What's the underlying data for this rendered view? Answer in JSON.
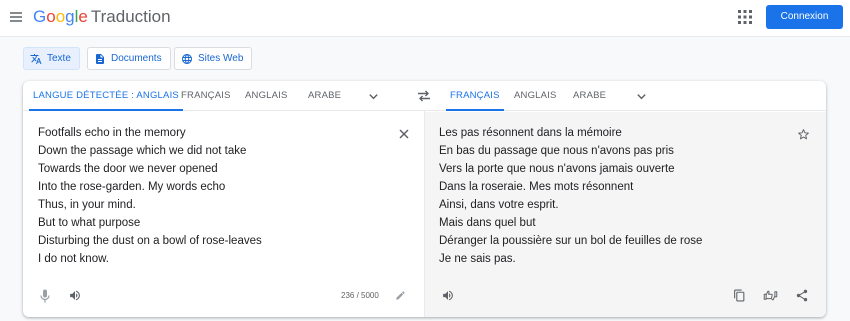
{
  "app": {
    "logo_letters": [
      "G",
      "o",
      "o",
      "g",
      "l",
      "e"
    ],
    "product_name": "Traduction",
    "sign_in_label": "Connexion",
    "menu_icon": "hamburger-menu-icon",
    "apps_icon": "apps-grid-icon"
  },
  "modes": [
    {
      "label": "Texte",
      "icon": "translate-icon",
      "active": true
    },
    {
      "label": "Documents",
      "icon": "document-icon",
      "active": false
    },
    {
      "label": "Sites Web",
      "icon": "globe-icon",
      "active": false
    }
  ],
  "source_langs": [
    {
      "label": "LANGUE DÉTECTÉE : ANGLAIS",
      "active": true
    },
    {
      "label": "FRANÇAIS",
      "active": false
    },
    {
      "label": "ANGLAIS",
      "active": false
    },
    {
      "label": "ARABE",
      "active": false
    }
  ],
  "target_langs": [
    {
      "label": "FRANÇAIS",
      "active": true
    },
    {
      "label": "ANGLAIS",
      "active": false
    },
    {
      "label": "ARABE",
      "active": false
    }
  ],
  "source_text": [
    "Footfalls echo in the memory",
    "Down the passage which we did not take",
    "Towards the door we never opened",
    "Into the rose-garden. My words echo",
    "Thus, in your mind.",
    "But to what purpose",
    "Disturbing the dust on a bowl of rose-leaves",
    "I do not know."
  ],
  "translated_text": [
    "Les pas résonnent dans la mémoire",
    "En bas du passage que nous n'avons pas pris",
    "Vers la porte que nous n'avons jamais ouverte",
    "Dans la roseraie. Mes mots résonnent",
    "Ainsi, dans votre esprit.",
    "Mais dans quel but",
    "Déranger la poussière sur un bol de feuilles de rose",
    "Je ne sais pas."
  ],
  "char_counter": "236 / 5000",
  "colors": {
    "accent": "#1a73e8",
    "signin_bg": "#1a73e8",
    "active_mode_bg": "#e8f0fe",
    "target_panel_bg": "#f5f5f5"
  }
}
